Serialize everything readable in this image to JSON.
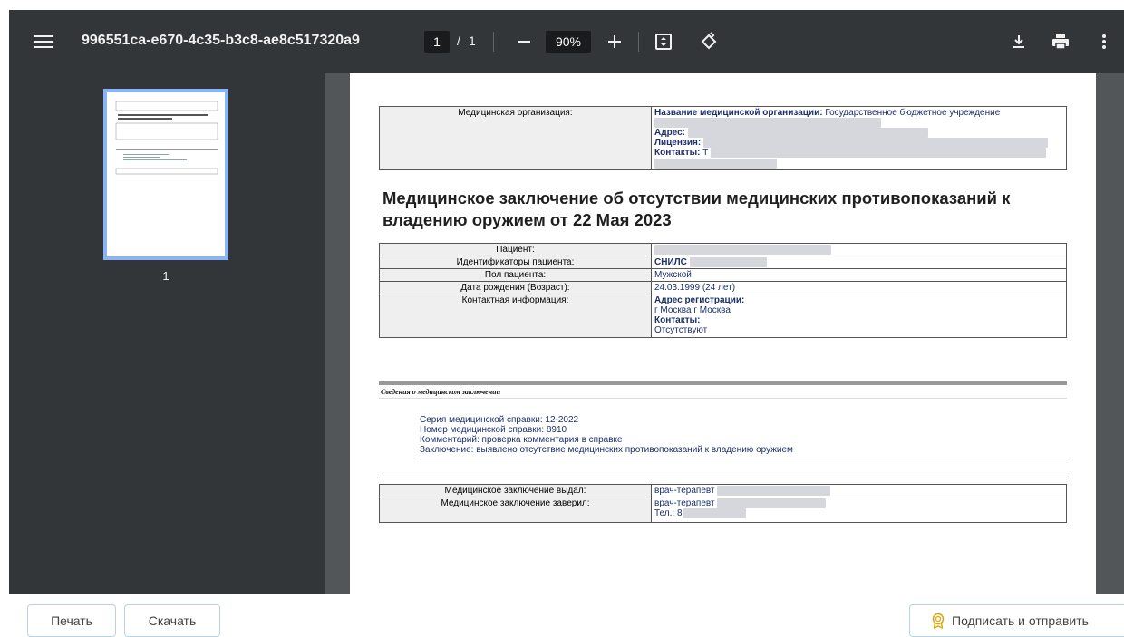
{
  "toolbar": {
    "title": "996551ca-e670-4c35-b3c8-ae8c517320a9",
    "page_current": "1",
    "page_separator": "/",
    "page_total": "1",
    "zoom": "90%",
    "icons": [
      "menu-icon",
      "zoom-out-icon",
      "zoom-in-icon",
      "fit-page-icon",
      "rotate-icon",
      "download-icon",
      "print-icon",
      "more-icon"
    ]
  },
  "thumbnails": {
    "page_label": "1"
  },
  "document": {
    "org": {
      "label": "Медицинская организация:",
      "name_label": "Название медицинской организации:",
      "name_value": "Государственное бюджетное учреждение",
      "address_label": "Адрес:",
      "license_label": "Лицензия:",
      "contacts_label": "Контакты:",
      "contacts_value": "Т"
    },
    "heading": "Медицинское заключение об отсутствии медицинских противопоказаний к владению оружием от 22 Мая 2023",
    "patient": {
      "patient_label": "Пациент:",
      "ids_label": "Идентификаторы пациента:",
      "ids_value": "СНИЛС",
      "sex_label": "Пол пациента:",
      "sex_value": "Мужской",
      "dob_label": "Дата рождения (Возраст):",
      "dob_value": "24.03.1999 (24 лет)",
      "contact_label": "Контактная информация:",
      "reg_address_label": "Адрес регистрации:",
      "reg_address_value": "г Москва г Москва",
      "contacts_label": "Контакты:",
      "contacts_value": "Отсутствуют"
    },
    "section": {
      "title": "Сведения о медицинском заключении",
      "lines": [
        "Серия медицинской справки: 12-2022",
        "Номер медицинской справки: 8910",
        "Комментарий: проверка комментария в справке",
        "Заключение: выявлено отсутствие медицинских противопоказаний к владению оружием"
      ]
    },
    "signers": {
      "issued_label": "Медицинское заключение выдал:",
      "issued_value": "врач-терапевт",
      "certified_label": "Медицинское заключение заверил:",
      "certified_value": "врач-терапевт",
      "phone_prefix": "Тел.: 8"
    }
  },
  "actions": {
    "print": "Печать",
    "download": "Скачать",
    "sign_send": "Подписать и отправить"
  },
  "colors": {
    "toolbar_bg": "#323639",
    "viewer_bg": "#525659",
    "thumb_border": "#8ab4f8",
    "button_border": "#b8d4e0",
    "sign_icon": "#e0a500"
  }
}
